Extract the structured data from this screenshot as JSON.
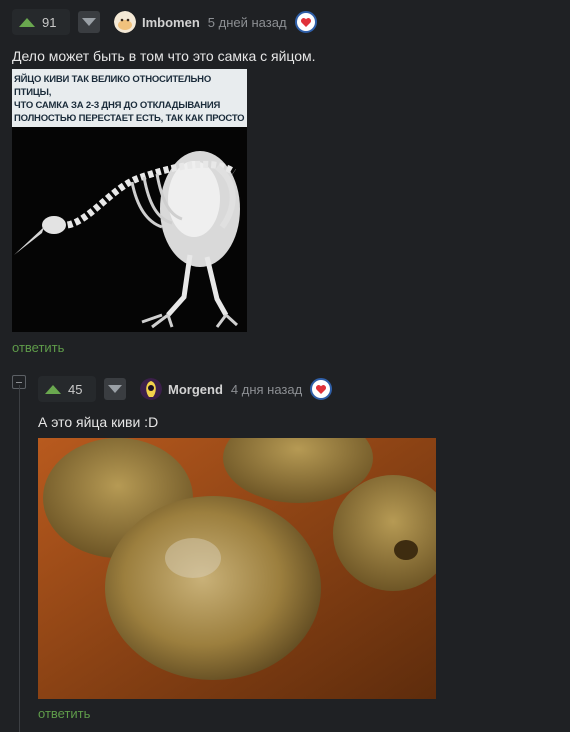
{
  "comments": [
    {
      "score": "91",
      "username": "Imbomen",
      "time": "5 дней назад",
      "text": "Дело может быть в том что это самка с яйцом.",
      "image_caption": "ЯЙЦО КИВИ ТАК ВЕЛИКО ОТНОСИТЕЛЬНО ПТИЦЫ,\nЧТО САМКА ЗА 2-3 ДНЯ ДО ОТКЛАДЫВАНИЯ\nПОЛНОСТЬЮ ПЕРЕСТАЕТ ЕСТЬ, ТАК КАК ПРОСТО\nНЕ ОСТАЕТСЯ МЕСТА ДЛЯ ЕДЫ.",
      "reply_label": "ответить",
      "icons": {
        "upvote": "arrow-up-icon",
        "downvote": "arrow-down-icon",
        "badge": "heart-badge-icon"
      }
    },
    {
      "score": "45",
      "username": "Morgend",
      "time": "4 дня назад",
      "text": "А это яйца киви :D",
      "reply_label": "ответить",
      "icons": {
        "upvote": "arrow-up-icon",
        "downvote": "arrow-down-icon",
        "badge": "heart-badge-icon"
      }
    }
  ],
  "colors": {
    "background": "#1f2124",
    "upvote": "#6aa84f",
    "reply_link": "#5f9c4a",
    "badge_heart": "#e0323a",
    "badge_ring": "#2f5fa8"
  }
}
